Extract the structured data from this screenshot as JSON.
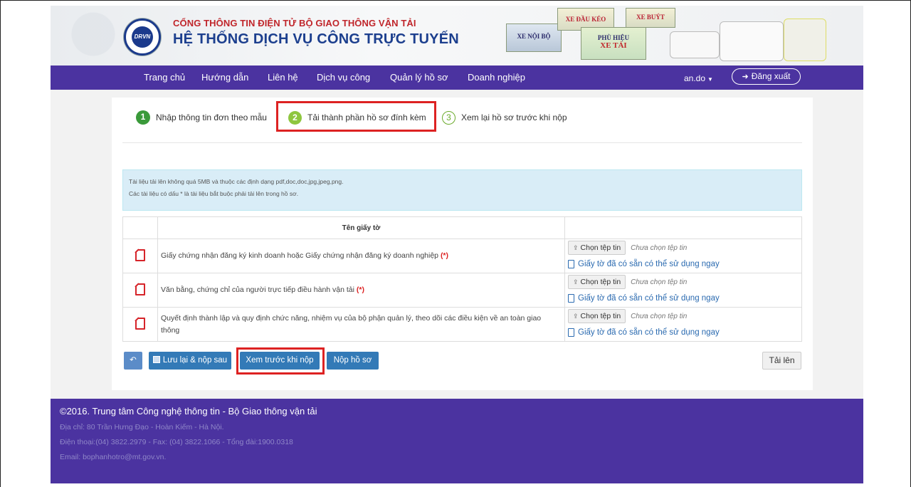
{
  "header": {
    "logo_text": "DRVN",
    "portal_title": "CỔNG THÔNG TIN ĐIỆN TỬ BỘ GIAO THÔNG VẬN TẢI",
    "system_title": "HỆ THỐNG DỊCH VỤ CÔNG TRỰC TUYẾN",
    "banner_cards": {
      "xe_noi_bo": "XE NỘI BỘ",
      "xe_dau_keo": "XE ĐẦU KÉO",
      "xe_buyt": "XE BUÝT",
      "phu_hieu": "PHÙ HIỆU",
      "xe_tai": "XE TẢI"
    }
  },
  "nav": {
    "items": [
      {
        "label": "Trang chủ"
      },
      {
        "label": "Hướng dẫn"
      },
      {
        "label": "Liên hệ"
      },
      {
        "label": "Dịch vụ công"
      },
      {
        "label": "Quản lý hồ sơ"
      },
      {
        "label": "Doanh nghiệp"
      }
    ],
    "user": "an.do",
    "logout": "Đăng xuất"
  },
  "steps": [
    {
      "num": "1",
      "label": "Nhập thông tin đơn theo mẫu"
    },
    {
      "num": "2",
      "label": "Tải thành phần hồ sơ đính kèm"
    },
    {
      "num": "3",
      "label": "Xem lại hồ sơ trước khi nộp"
    }
  ],
  "info": {
    "line1": "Tài liệu tải lên không quá 5MB và thuộc các định dạng pdf,doc,doc,jpg,jpeg,png.",
    "line2": "Các tài liệu có dấu * là tài liệu bắt buộc phải tải lên trong hồ sơ."
  },
  "table": {
    "header": "Tên giấy tờ",
    "choose_label": "Chọn tệp tin",
    "no_file": "Chưa chọn tệp tin",
    "available_link": "Giấy tờ đã có sẵn có thể sử dụng ngay",
    "required_mark": "(*)",
    "rows": [
      {
        "name": "Giấy chứng nhận đăng ký kinh doanh hoặc Giấy chứng nhận đăng ký doanh nghiệp"
      },
      {
        "name": "Văn bằng, chứng chỉ của người trực tiếp điều hành vận tải"
      },
      {
        "name": "Quyết định thành lập và quy định chức năng, nhiệm vụ của bộ phận quản lý, theo dõi các điều kiện về an toàn giao thông"
      }
    ]
  },
  "toolbar": {
    "save_later": "Lưu lại & nộp sau",
    "preview": "Xem trước khi nộp",
    "submit": "Nộp hồ sơ",
    "upload": "Tải lên"
  },
  "footer": {
    "title": "©2016. Trung tâm Công nghệ thông tin - Bộ Giao thông vận tải",
    "address": "Địa chỉ: 80 Trần Hưng Đạo - Hoàn Kiếm - Hà Nội.",
    "phone": "Điện thoại:(04) 3822.2979 - Fax: (04) 3822.1066 - Tổng đài:1900.0318",
    "email": "Email: bophanhotro@mt.gov.vn."
  }
}
